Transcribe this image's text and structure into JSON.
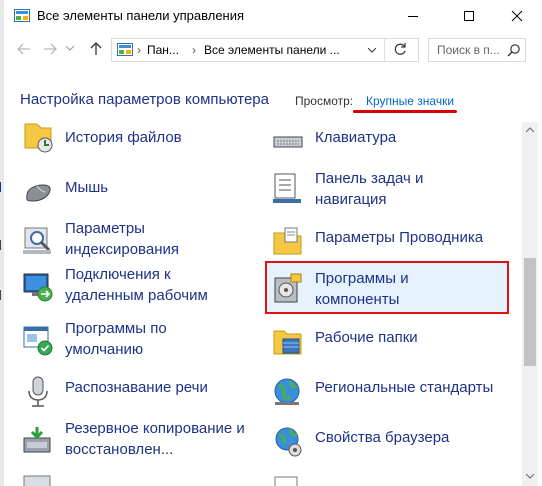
{
  "window": {
    "title": "Все элементы панели управления",
    "minimize_icon": "minimize-icon",
    "maximize_icon": "maximize-icon",
    "close_icon": "close-icon"
  },
  "address_bar": {
    "segment_1": "Пан...",
    "segment_2": "Все элементы панели ...",
    "search_placeholder": "Поиск в п..."
  },
  "header": {
    "title": "Настройка параметров компьютера",
    "view_label": "Просмотр:",
    "view_value": "Крупные значки"
  },
  "items_left": [
    {
      "label": "История файлов",
      "icon": "file-history-icon"
    },
    {
      "label": "Мышь",
      "icon": "mouse-icon"
    },
    {
      "label": "Параметры\nиндексирования",
      "icon": "indexing-options-icon"
    },
    {
      "label": "Подключения к\nудаленным рабочим",
      "icon": "remote-desktop-icon"
    },
    {
      "label": "Программы по\nумолчанию",
      "icon": "default-programs-icon"
    },
    {
      "label": "Распознавание речи",
      "icon": "microphone-icon"
    },
    {
      "label": "Резервное копирование и\nвосстановлен...",
      "icon": "backup-restore-icon"
    }
  ],
  "items_right": [
    {
      "label": "Клавиатура",
      "icon": "keyboard-icon"
    },
    {
      "label": "Панель задач и\nнавигация",
      "icon": "taskbar-icon"
    },
    {
      "label": "Параметры Проводника",
      "icon": "explorer-options-icon"
    },
    {
      "label": "Программы и\nкомпоненты",
      "icon": "programs-features-icon"
    },
    {
      "label": "Рабочие папки",
      "icon": "work-folders-icon"
    },
    {
      "label": "Региональные стандарты",
      "icon": "region-globe-icon"
    },
    {
      "label": "Свойства браузера",
      "icon": "internet-options-icon"
    }
  ],
  "colors": {
    "link": "#1e3287",
    "highlight_border": "#e01010",
    "highlight_fill": "#e5f1fb"
  }
}
